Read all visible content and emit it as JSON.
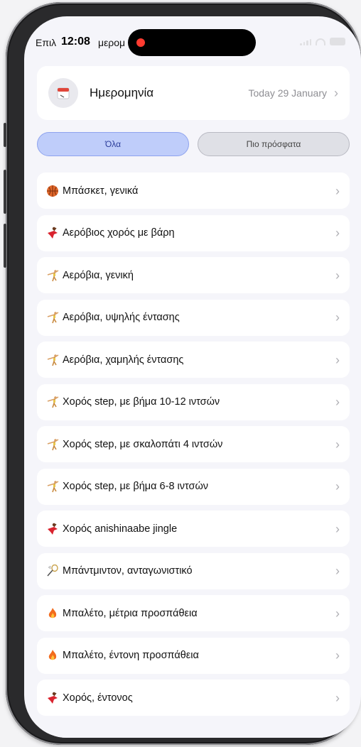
{
  "status_bar": {
    "title_fragment": "Επιλ",
    "title_fragment_right": "μερομ",
    "time": "12:08"
  },
  "date_row": {
    "icon": "calendar-icon",
    "label": "Ημερομηνία",
    "value": "Today 29 January"
  },
  "filters": [
    {
      "label": "Όλα",
      "selected": true
    },
    {
      "label": "Πιο πρόσφατα",
      "selected": false
    }
  ],
  "activities": [
    {
      "label": "Μπάσκετ, γενικά",
      "icon": "basketball-icon"
    },
    {
      "label": "Αερόβιος χορός με βάρη",
      "icon": "dancer-icon"
    },
    {
      "label": "Αερόβια, γενική",
      "icon": "aerobics-icon"
    },
    {
      "label": "Αερόβια, υψηλής έντασης",
      "icon": "aerobics-icon"
    },
    {
      "label": "Αερόβια, χαμηλής έντασης",
      "icon": "aerobics-icon"
    },
    {
      "label": "Χορός step, με βήμα 10-12 ιντσών",
      "icon": "aerobics-icon"
    },
    {
      "label": "Χορός step, με σκαλοπάτι 4 ιντσών",
      "icon": "aerobics-icon"
    },
    {
      "label": "Χορός step, με βήμα 6-8 ιντσών",
      "icon": "aerobics-icon"
    },
    {
      "label": "Χορός anishinaabe jingle",
      "icon": "dancer-icon"
    },
    {
      "label": "Μπάντμιντον, ανταγωνιστικό",
      "icon": "badminton-icon"
    },
    {
      "label": "Μπαλέτο, μέτρια προσπάθεια",
      "icon": "fire-icon"
    },
    {
      "label": "Μπαλέτο, έντονη προσπάθεια",
      "icon": "fire-icon"
    },
    {
      "label": "Χορός, έντονος",
      "icon": "dancer-icon"
    }
  ],
  "colors": {
    "accent_pill_bg": "#bfcdfa",
    "accent_pill_border": "#8ea3ee",
    "screen_bg": "#f5f5fa"
  }
}
